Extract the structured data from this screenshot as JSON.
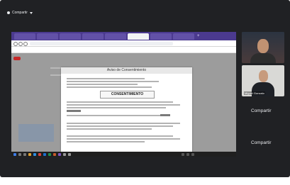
{
  "meet": {
    "presenter_label": "Compartir",
    "compartir_label": "Compartir"
  },
  "browser": {
    "tabs": [
      "",
      "",
      "",
      "",
      "",
      "",
      "",
      ""
    ],
    "url": "",
    "bookmarks": [
      "",
      "",
      "",
      "",
      "",
      "",
      "",
      "",
      "",
      "",
      "",
      ""
    ]
  },
  "modal": {
    "title": "Aviso de Consentimiento",
    "section_title": "CONSENTIMIENTO"
  },
  "participants": [
    {
      "name": ""
    },
    {
      "name": "Miguel Gonzalo"
    }
  ],
  "colors": {
    "meet_bg": "#202124",
    "tabstrip": "#4b3a8f",
    "tile_bg": "#3c4043"
  },
  "icons": [
    "presenter-icon",
    "dropdown-arrow-icon",
    "back-icon",
    "forward-icon",
    "reload-icon"
  ]
}
